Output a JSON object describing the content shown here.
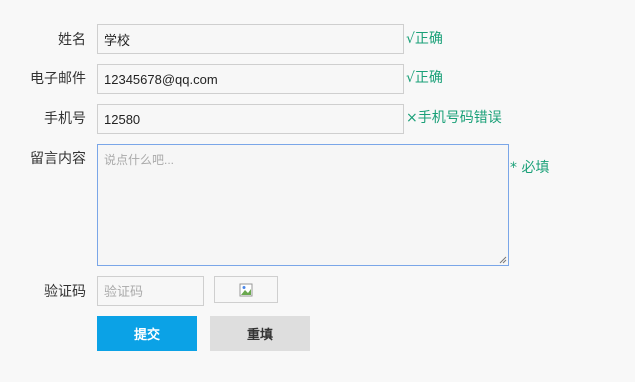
{
  "form": {
    "name": {
      "label": "姓名",
      "value": "学校",
      "status": "√正确",
      "status_color": "#1aa078"
    },
    "email": {
      "label": "电子邮件",
      "value": "12345678@qq.com",
      "status": "√正确",
      "status_color": "#1aa078"
    },
    "phone": {
      "label": "手机号",
      "value": "12580",
      "status": "×手机号码错误",
      "status_color": "#1aa078"
    },
    "message": {
      "label": "留言内容",
      "placeholder": "说点什么吧...",
      "status": "* 必填",
      "status_color": "#1aa078"
    },
    "captcha": {
      "label": "验证码",
      "placeholder": "验证码",
      "image_icon": "broken-image-icon"
    }
  },
  "buttons": {
    "submit": {
      "label": "提交",
      "bg": "#0ba2e6",
      "color": "#ffffff"
    },
    "reset": {
      "label": "重填",
      "bg": "#dedede",
      "color": "#333333"
    }
  }
}
